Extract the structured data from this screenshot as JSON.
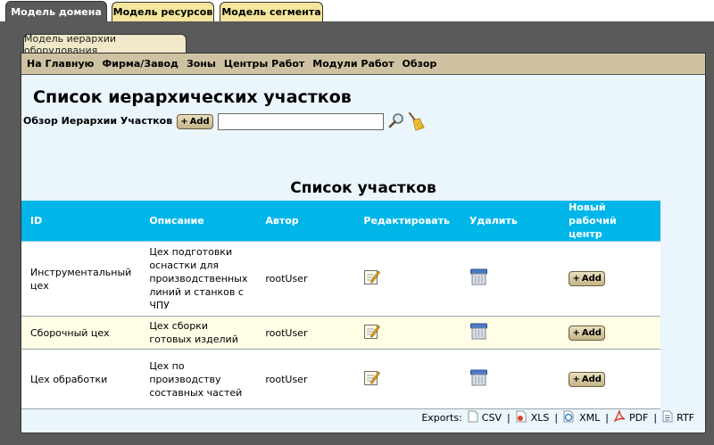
{
  "top_tabs": [
    {
      "label": "Модель домена",
      "active": true
    },
    {
      "label": "Модель ресурсов",
      "active": false
    },
    {
      "label": "Модель сегмента",
      "active": false
    }
  ],
  "sub_tab": {
    "label": "Модель иерархии оборудования"
  },
  "nav": [
    "На Главную",
    "Фирма/Завод",
    "Зоны",
    "Центры Работ",
    "Модули Работ",
    "Обзор"
  ],
  "page": {
    "title": "Список иерархических участков",
    "search_label": "Обзор Иерархии Участков",
    "add_label": "Add",
    "search_value": "",
    "search_placeholder": "",
    "list_title": "Список участков"
  },
  "table": {
    "columns": [
      "ID",
      "Описание",
      "Автор",
      "Редактировать",
      "Удалить",
      "Новый рабочий центр"
    ],
    "rows": [
      {
        "id": "Инструментальный цех",
        "description": "Цех подготовки оснастки для производственных линий и станков с ЧПУ",
        "author": "rootUser",
        "add_label": "Add"
      },
      {
        "id": "Сборочный цех",
        "description": "Цех сборки готовых изделий",
        "author": "rootUser",
        "add_label": "Add"
      },
      {
        "id": "Цех обработки",
        "description": "Цех по производству составных частей",
        "author": "rootUser",
        "add_label": "Add"
      }
    ]
  },
  "exports": {
    "label": "Exports:",
    "formats": [
      {
        "label": "CSV",
        "icon": "csv-file-icon"
      },
      {
        "label": "XLS",
        "icon": "xls-file-icon"
      },
      {
        "label": "XML",
        "icon": "xml-file-icon"
      },
      {
        "label": "PDF",
        "icon": "pdf-file-icon"
      },
      {
        "label": "RTF",
        "icon": "rtf-file-icon"
      }
    ]
  },
  "colors": {
    "frame": "#5a5a5a",
    "tab_inactive": "#f4e69c",
    "navbar": "#cfc2a2",
    "panel": "#eaf5fc",
    "table_header": "#00b6e8",
    "row_alt": "#fffde6"
  }
}
